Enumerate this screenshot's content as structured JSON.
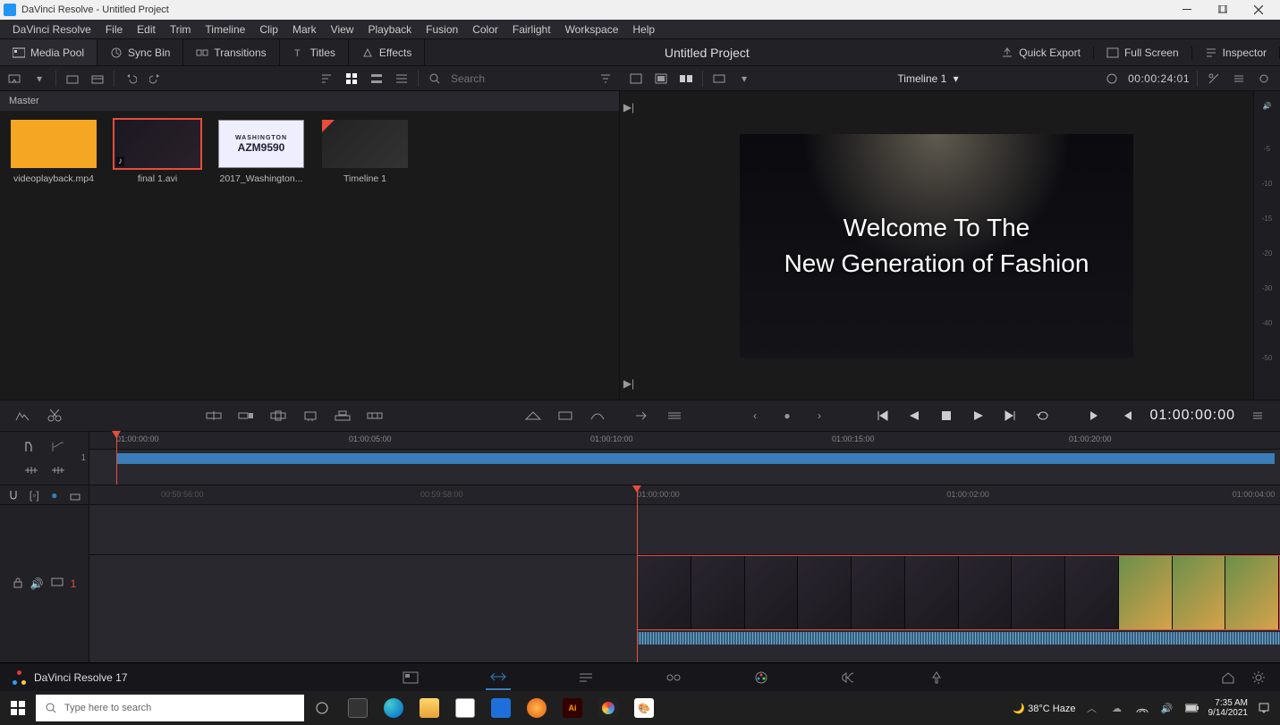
{
  "window": {
    "app": "DaVinci Resolve",
    "title": "DaVinci Resolve - Untitled Project",
    "project": "Untitled Project"
  },
  "menu": [
    "DaVinci Resolve",
    "File",
    "Edit",
    "Trim",
    "Timeline",
    "Clip",
    "Mark",
    "View",
    "Playback",
    "Fusion",
    "Color",
    "Fairlight",
    "Workspace",
    "Help"
  ],
  "topbar": {
    "mediaPool": "Media Pool",
    "syncBin": "Sync Bin",
    "transitions": "Transitions",
    "titles": "Titles",
    "effects": "Effects",
    "quickExport": "Quick Export",
    "fullScreen": "Full Screen",
    "inspector": "Inspector"
  },
  "pool": {
    "header": "Master",
    "searchPlaceholder": "Search",
    "clips": [
      {
        "label": "videoplayback.mp4"
      },
      {
        "label": "final 1.avi"
      },
      {
        "label": "2017_Washington..."
      },
      {
        "label": "Timeline 1"
      }
    ],
    "plateTop": "WASHINGTON",
    "plateText": "AZM9590"
  },
  "viewer": {
    "timeline": "Timeline 1",
    "durationTC": "00:00:24:01",
    "overlayLine1": "Welcome To The",
    "overlayLine2": "New Generation of Fashion",
    "meterMarks": [
      "-5",
      "-10",
      "-15",
      "-20",
      "-30",
      "-40",
      "-50"
    ]
  },
  "transport": {
    "posTC": "01:00:00:00"
  },
  "overview": {
    "ticks": [
      "01:00:00:00",
      "01:00:05:00",
      "01:00:10:00",
      "01:00:15:00",
      "01:00:20:00"
    ],
    "trackNum": "1"
  },
  "timeline": {
    "ticksGrey": [
      "00:59:56:00",
      "00:59:58:00"
    ],
    "ticks": [
      "01:00:00:00",
      "01:00:02:00",
      "01:00:04:00"
    ],
    "trackNum": "1"
  },
  "pages": {
    "version": "DaVinci Resolve 17"
  },
  "taskbar": {
    "searchPlaceholder": "Type here to search",
    "weather": "38°C  Haze",
    "time": "7:35 AM",
    "date": "9/14/2021"
  }
}
